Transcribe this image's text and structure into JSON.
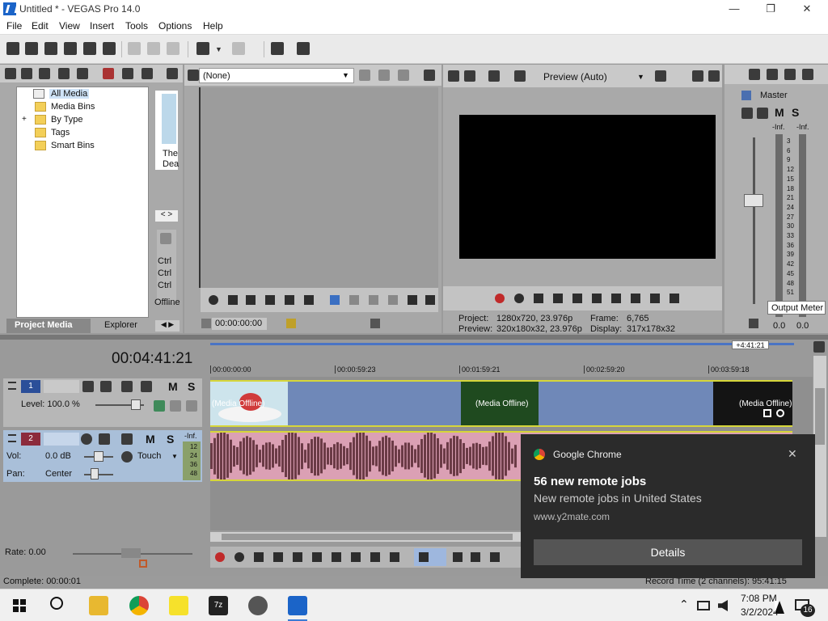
{
  "window": {
    "title": "Untitled * - VEGAS Pro 14.0",
    "minimize": "—",
    "restore": "❐",
    "close": "✕"
  },
  "menu": [
    "File",
    "Edit",
    "View",
    "Insert",
    "Tools",
    "Options",
    "Help"
  ],
  "project_media": {
    "tree": [
      "All Media",
      "Media Bins",
      "By Type",
      "Tags",
      "Smart Bins"
    ],
    "expand": "+",
    "tabs": [
      "Project Media",
      "Explorer"
    ],
    "thumb_caption_1": "The",
    "thumb_caption_2": "Dea",
    "side_items": [
      "Ctrl",
      "Ctrl",
      "Ctrl",
      "Offline"
    ]
  },
  "trimmer": {
    "dropdown": "(None)",
    "timecode": "00:00:00:00"
  },
  "video_preview": {
    "mode": "Preview (Auto)",
    "project_label": "Project:",
    "project_value": "1280x720, 23.976p",
    "preview_label": "Preview:",
    "preview_value": "320x180x32, 23.976p",
    "frame_label": "Frame:",
    "frame_value": "6,765",
    "display_label": "Display:",
    "display_value": "317x178x32"
  },
  "master": {
    "title": "Master",
    "m": "M",
    "s": "S",
    "inf_left": "-Inf.",
    "inf_right": "-Inf.",
    "scale": [
      "3",
      "6",
      "9",
      "12",
      "15",
      "18",
      "21",
      "24",
      "27",
      "30",
      "33",
      "36",
      "39",
      "42",
      "45",
      "48",
      "51"
    ],
    "tooltip": "Output Meter",
    "bottom_left": "0.0",
    "bottom_right": "0.0"
  },
  "timeline": {
    "cursor_time": "00:04:41:21",
    "end_marker": "+4:41:21",
    "ruler": [
      "00:00:00:00",
      "00:00:59:23",
      "00:01:59:21",
      "00:02:59:20",
      "00:03:59:18"
    ],
    "track1_num": "1",
    "track1_level": "Level: 100.0 %",
    "track2_num": "2",
    "track2_vol": "Vol:",
    "track2_vol_value": "0.0 dB",
    "track2_pan": "Pan:",
    "track2_pan_value": "Center",
    "track2_mode": "Touch",
    "m": "M",
    "s": "S",
    "meter_labels": [
      "-Inf.",
      "12",
      "24",
      "36",
      "48"
    ],
    "clip_label": "(Media Offline)",
    "rate": "Rate: 0.00",
    "complete": "Complete: 00:00:01",
    "record_time": "Record Time (2 channels): 95:41:15"
  },
  "notification": {
    "app": "Google Chrome",
    "title": "56 new remote jobs",
    "body": "New remote jobs in United States",
    "url": "www.y2mate.com",
    "button": "Details",
    "close": "✕"
  },
  "taskbar": {
    "time": "7:08 PM",
    "date": "3/2/2024",
    "notif_count": "16",
    "apps": [
      "start",
      "search",
      "file-explorer",
      "chrome",
      "sticky-notes",
      "7zip",
      "media-player",
      "vegas"
    ]
  }
}
